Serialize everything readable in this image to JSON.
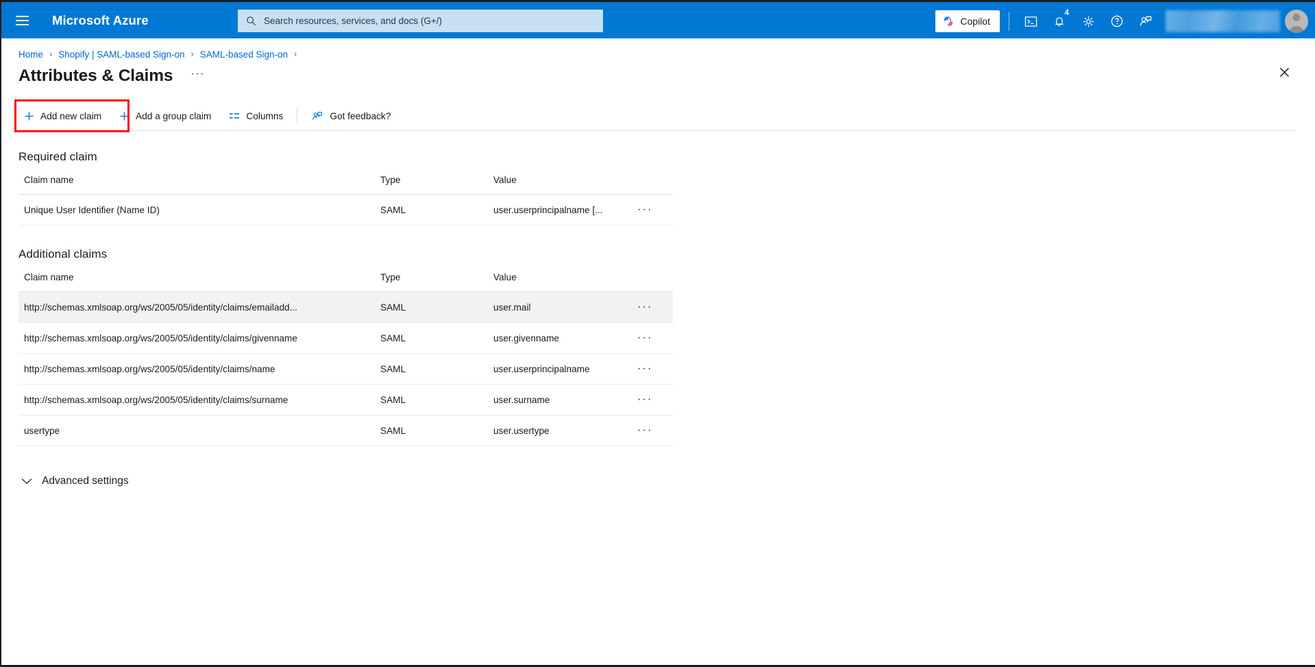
{
  "topbar": {
    "menu_icon": "hamburger-menu-icon",
    "brand": "Microsoft Azure",
    "search": {
      "icon": "search-icon",
      "placeholder": "Search resources, services, and docs (G+/)",
      "value": ""
    },
    "copilot_label": "Copilot",
    "copilot_icon": "copilot-icon",
    "icons": [
      {
        "name": "cloud-shell-icon",
        "label": "Cloud Shell"
      },
      {
        "name": "notifications-bell-icon",
        "label": "Notifications",
        "badge": "4"
      },
      {
        "name": "settings-gear-icon",
        "label": "Settings"
      },
      {
        "name": "help-question-icon",
        "label": "Help"
      },
      {
        "name": "feedback-person-icon",
        "label": "Feedback"
      }
    ],
    "account_redacted": "",
    "avatar_icon": "user-avatar-icon",
    "accent_color": "#0078d4",
    "search_bg_color": "#c7e0f4"
  },
  "breadcrumb": {
    "items": [
      {
        "label": "Home"
      },
      {
        "label": "Shopify | SAML-based Sign-on"
      },
      {
        "label": "SAML-based Sign-on"
      }
    ],
    "separator": "›"
  },
  "header": {
    "title": "Attributes & Claims",
    "more_options": "···",
    "close_icon": "close-icon"
  },
  "commandbar": {
    "buttons": [
      {
        "name": "add-new-claim-button",
        "label": "Add new claim",
        "icon": "plus-icon",
        "highlighted": true
      },
      {
        "name": "add-group-claim-button",
        "label": "Add a group claim",
        "icon": "plus-icon",
        "highlighted": false
      },
      {
        "name": "columns-button",
        "label": "Columns",
        "icon": "columns-icon",
        "highlighted": false
      },
      {
        "name": "got-feedback-button",
        "label": "Got feedback?",
        "icon": "feedback-person-icon",
        "highlighted": false
      }
    ],
    "highlight_color": "#ff0000"
  },
  "required_claim": {
    "section_title": "Required claim",
    "columns": [
      "Claim name",
      "Type",
      "Value"
    ],
    "rows": [
      {
        "claim_name": "Unique User Identifier (Name ID)",
        "type": "SAML",
        "value": "user.userprincipalname [...",
        "menu": "···",
        "selected": false
      }
    ]
  },
  "additional_claims": {
    "section_title": "Additional claims",
    "columns": [
      "Claim name",
      "Type",
      "Value"
    ],
    "rows": [
      {
        "claim_name": "http://schemas.xmlsoap.org/ws/2005/05/identity/claims/emailadd...",
        "type": "SAML",
        "value": "user.mail",
        "menu": "···",
        "selected": true
      },
      {
        "claim_name": "http://schemas.xmlsoap.org/ws/2005/05/identity/claims/givenname",
        "type": "SAML",
        "value": "user.givenname",
        "menu": "···",
        "selected": false
      },
      {
        "claim_name": "http://schemas.xmlsoap.org/ws/2005/05/identity/claims/name",
        "type": "SAML",
        "value": "user.userprincipalname",
        "menu": "···",
        "selected": false
      },
      {
        "claim_name": "http://schemas.xmlsoap.org/ws/2005/05/identity/claims/surname",
        "type": "SAML",
        "value": "user.surname",
        "menu": "···",
        "selected": false
      },
      {
        "claim_name": "usertype",
        "type": "SAML",
        "value": "user.usertype",
        "menu": "···",
        "selected": false
      }
    ]
  },
  "advanced_settings": {
    "label": "Advanced settings",
    "chevron_icon": "chevron-down-icon",
    "expanded": false
  }
}
